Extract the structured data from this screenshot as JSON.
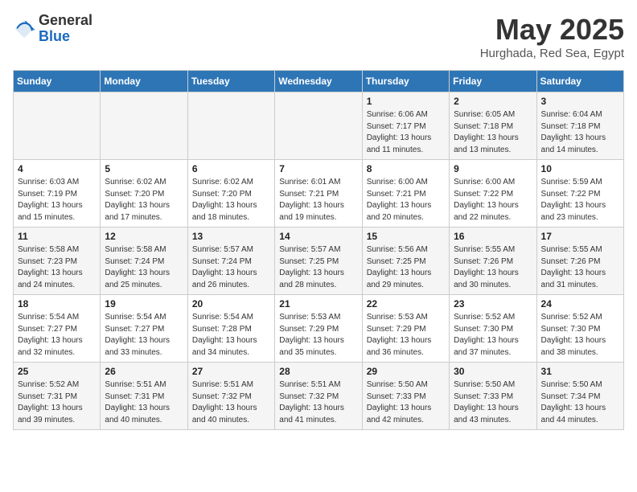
{
  "header": {
    "logo_general": "General",
    "logo_blue": "Blue",
    "month_title": "May 2025",
    "subtitle": "Hurghada, Red Sea, Egypt"
  },
  "calendar": {
    "days_of_week": [
      "Sunday",
      "Monday",
      "Tuesday",
      "Wednesday",
      "Thursday",
      "Friday",
      "Saturday"
    ],
    "weeks": [
      [
        {
          "day": "",
          "info": ""
        },
        {
          "day": "",
          "info": ""
        },
        {
          "day": "",
          "info": ""
        },
        {
          "day": "",
          "info": ""
        },
        {
          "day": "1",
          "info": "Sunrise: 6:06 AM\nSunset: 7:17 PM\nDaylight: 13 hours\nand 11 minutes."
        },
        {
          "day": "2",
          "info": "Sunrise: 6:05 AM\nSunset: 7:18 PM\nDaylight: 13 hours\nand 13 minutes."
        },
        {
          "day": "3",
          "info": "Sunrise: 6:04 AM\nSunset: 7:18 PM\nDaylight: 13 hours\nand 14 minutes."
        }
      ],
      [
        {
          "day": "4",
          "info": "Sunrise: 6:03 AM\nSunset: 7:19 PM\nDaylight: 13 hours\nand 15 minutes."
        },
        {
          "day": "5",
          "info": "Sunrise: 6:02 AM\nSunset: 7:20 PM\nDaylight: 13 hours\nand 17 minutes."
        },
        {
          "day": "6",
          "info": "Sunrise: 6:02 AM\nSunset: 7:20 PM\nDaylight: 13 hours\nand 18 minutes."
        },
        {
          "day": "7",
          "info": "Sunrise: 6:01 AM\nSunset: 7:21 PM\nDaylight: 13 hours\nand 19 minutes."
        },
        {
          "day": "8",
          "info": "Sunrise: 6:00 AM\nSunset: 7:21 PM\nDaylight: 13 hours\nand 20 minutes."
        },
        {
          "day": "9",
          "info": "Sunrise: 6:00 AM\nSunset: 7:22 PM\nDaylight: 13 hours\nand 22 minutes."
        },
        {
          "day": "10",
          "info": "Sunrise: 5:59 AM\nSunset: 7:22 PM\nDaylight: 13 hours\nand 23 minutes."
        }
      ],
      [
        {
          "day": "11",
          "info": "Sunrise: 5:58 AM\nSunset: 7:23 PM\nDaylight: 13 hours\nand 24 minutes."
        },
        {
          "day": "12",
          "info": "Sunrise: 5:58 AM\nSunset: 7:24 PM\nDaylight: 13 hours\nand 25 minutes."
        },
        {
          "day": "13",
          "info": "Sunrise: 5:57 AM\nSunset: 7:24 PM\nDaylight: 13 hours\nand 26 minutes."
        },
        {
          "day": "14",
          "info": "Sunrise: 5:57 AM\nSunset: 7:25 PM\nDaylight: 13 hours\nand 28 minutes."
        },
        {
          "day": "15",
          "info": "Sunrise: 5:56 AM\nSunset: 7:25 PM\nDaylight: 13 hours\nand 29 minutes."
        },
        {
          "day": "16",
          "info": "Sunrise: 5:55 AM\nSunset: 7:26 PM\nDaylight: 13 hours\nand 30 minutes."
        },
        {
          "day": "17",
          "info": "Sunrise: 5:55 AM\nSunset: 7:26 PM\nDaylight: 13 hours\nand 31 minutes."
        }
      ],
      [
        {
          "day": "18",
          "info": "Sunrise: 5:54 AM\nSunset: 7:27 PM\nDaylight: 13 hours\nand 32 minutes."
        },
        {
          "day": "19",
          "info": "Sunrise: 5:54 AM\nSunset: 7:27 PM\nDaylight: 13 hours\nand 33 minutes."
        },
        {
          "day": "20",
          "info": "Sunrise: 5:54 AM\nSunset: 7:28 PM\nDaylight: 13 hours\nand 34 minutes."
        },
        {
          "day": "21",
          "info": "Sunrise: 5:53 AM\nSunset: 7:29 PM\nDaylight: 13 hours\nand 35 minutes."
        },
        {
          "day": "22",
          "info": "Sunrise: 5:53 AM\nSunset: 7:29 PM\nDaylight: 13 hours\nand 36 minutes."
        },
        {
          "day": "23",
          "info": "Sunrise: 5:52 AM\nSunset: 7:30 PM\nDaylight: 13 hours\nand 37 minutes."
        },
        {
          "day": "24",
          "info": "Sunrise: 5:52 AM\nSunset: 7:30 PM\nDaylight: 13 hours\nand 38 minutes."
        }
      ],
      [
        {
          "day": "25",
          "info": "Sunrise: 5:52 AM\nSunset: 7:31 PM\nDaylight: 13 hours\nand 39 minutes."
        },
        {
          "day": "26",
          "info": "Sunrise: 5:51 AM\nSunset: 7:31 PM\nDaylight: 13 hours\nand 40 minutes."
        },
        {
          "day": "27",
          "info": "Sunrise: 5:51 AM\nSunset: 7:32 PM\nDaylight: 13 hours\nand 40 minutes."
        },
        {
          "day": "28",
          "info": "Sunrise: 5:51 AM\nSunset: 7:32 PM\nDaylight: 13 hours\nand 41 minutes."
        },
        {
          "day": "29",
          "info": "Sunrise: 5:50 AM\nSunset: 7:33 PM\nDaylight: 13 hours\nand 42 minutes."
        },
        {
          "day": "30",
          "info": "Sunrise: 5:50 AM\nSunset: 7:33 PM\nDaylight: 13 hours\nand 43 minutes."
        },
        {
          "day": "31",
          "info": "Sunrise: 5:50 AM\nSunset: 7:34 PM\nDaylight: 13 hours\nand 44 minutes."
        }
      ]
    ]
  }
}
